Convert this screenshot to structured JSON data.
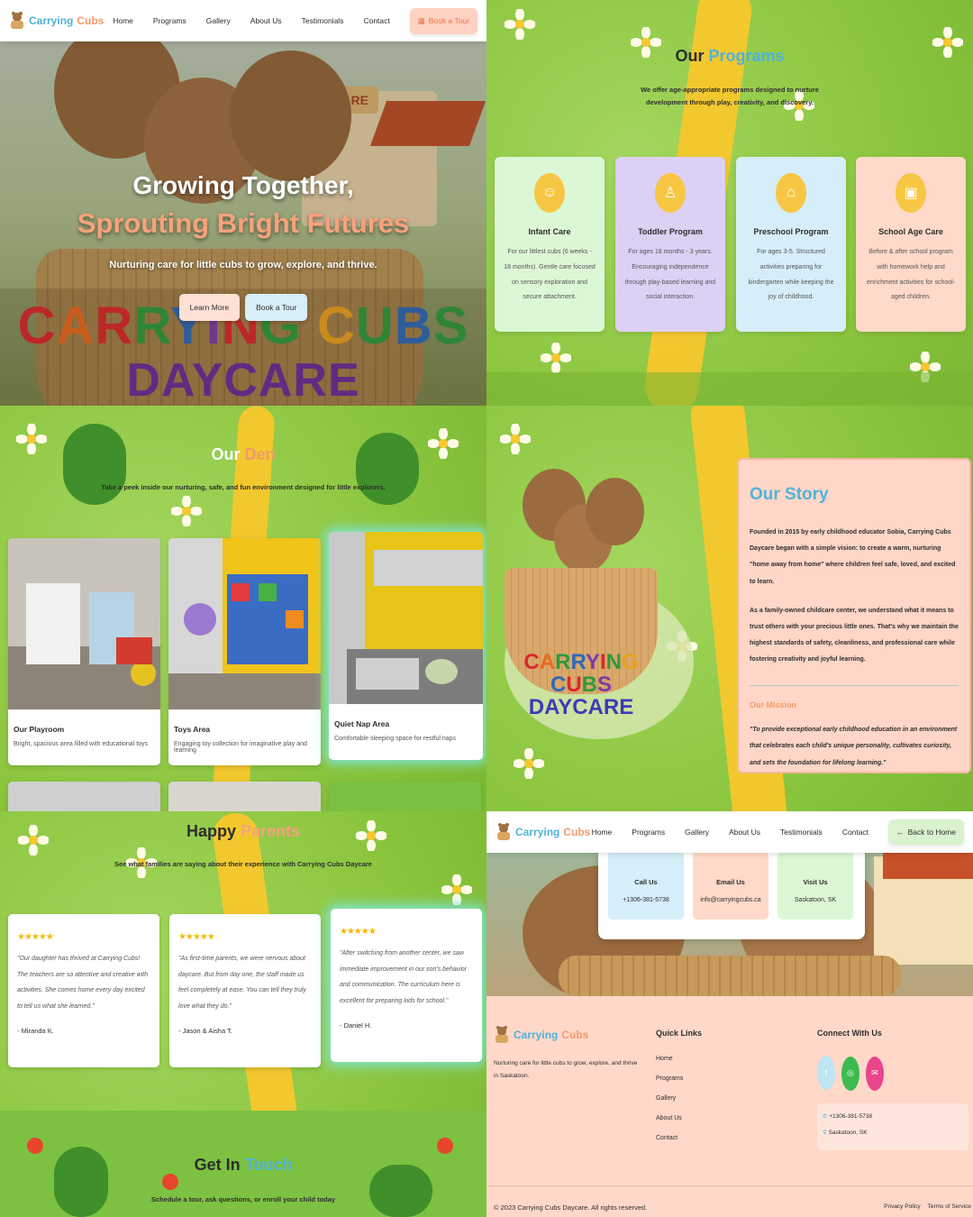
{
  "brand": {
    "word1": "Carrying",
    "word2": "Cubs"
  },
  "nav": {
    "links": [
      "Home",
      "Programs",
      "Gallery",
      "About Us",
      "Testimonials",
      "Contact"
    ],
    "cta": "Book a Tour",
    "back": "Back to Home"
  },
  "hero": {
    "title_line1": "Growing Together,",
    "title_line2": "Sprouting Bright Futures",
    "subtitle": "Nurturing care for little cubs to grow, explore, and thrive.",
    "btn_learn": "Learn More",
    "btn_tour": "Book a Tour",
    "brand_line1": "CARRYING CUBS",
    "brand_line2": "DAYCARE",
    "sign": "DAYCARE"
  },
  "programs": {
    "title_a": "Our",
    "title_b": "Programs",
    "subtitle": "We offer age-appropriate programs designed to nurture development through play, creativity, and discovery.",
    "items": [
      {
        "title": "Infant Care",
        "desc": "For our littlest cubs (6 weeks - 18 months). Gentle care focused on sensory exploration and secure attachment.",
        "bg": "#dcf7d6"
      },
      {
        "title": "Toddler Program",
        "desc": "For ages 18 months - 3 years. Encouraging independence through play-based learning and social interaction.",
        "bg": "#ddd0f5"
      },
      {
        "title": "Preschool Program",
        "desc": "For ages 3-5. Structured activities preparing for kindergarten while keeping the joy of childhood.",
        "bg": "#d6eef9"
      },
      {
        "title": "School Age Care",
        "desc": "Before & after school program with homework help and enrichment activities for school-aged children.",
        "bg": "#ffd9c9"
      }
    ]
  },
  "gallery": {
    "title_a": "Our",
    "title_b": "Den",
    "subtitle": "Take a peek inside our nurturing, safe, and fun environment designed for little explorers.",
    "items": [
      {
        "name": "Our Playroom",
        "desc": "Bright, spacious area filled with educational toys"
      },
      {
        "name": "Toys Area",
        "desc": "Engaging toy collection for imaginative play and learning"
      },
      {
        "name": "Quiet Nap Area",
        "desc": "Comfortable sleeping space for restful naps"
      }
    ]
  },
  "story": {
    "title": "Our Story",
    "p1": "Founded in 2015 by early childhood educator Sobia, Carrying Cubs Daycare began with a simple vision: to create a warm, nurturing \"home away from home\" where children feel safe, loved, and excited to learn.",
    "p2": "As a family-owned childcare center, we understand what it means to trust others with your precious little ones. That's why we maintain the highest standards of safety, cleanliness, and professional care while fostering creativity and joyful learning.",
    "mission_title": "Our Mission",
    "mission": "\"To provide exceptional early childhood education in an environment that celebrates each child's unique personality, cultivates curiosity, and sets the foundation for lifelong learning.\"",
    "art_line1": "CARRYING CUBS",
    "art_line2": "DAYCARE"
  },
  "testimonials": {
    "title_a": "Happy",
    "title_b": "Parents",
    "subtitle": "See what families are saying about their experience with Carrying Cubs Daycare",
    "stars": "★★★★★",
    "items": [
      {
        "quote": "\"Our daughter has thrived at Carrying Cubs! The teachers are so attentive and creative with activities. She comes home every day excited to tell us what she learned.\"",
        "name": "- Miranda K."
      },
      {
        "quote": "\"As first-time parents, we were nervous about daycare. But from day one, the staff made us feel completely at ease. You can tell they truly love what they do.\"",
        "name": "- Jason & Aisha T."
      },
      {
        "quote": "\"After switching from another center, we saw immediate improvement in our son's behavior and communication. The curriculum here is excellent for preparing kids for school.\"",
        "name": "- Daniel H."
      }
    ]
  },
  "contact": {
    "title_a": "Get In",
    "title_b": "Touch",
    "subtitle": "Schedule a tour, ask questions, or enroll your child today",
    "boxes": [
      {
        "label": "Call Us",
        "value": "+1306-381-5738"
      },
      {
        "label": "Email Us",
        "value": "info@carryingcubs.ca"
      },
      {
        "label": "Visit Us",
        "value": "Saskatoon, SK"
      }
    ]
  },
  "footer": {
    "about": "Nurturing care for little cubs to grow, explore, and thrive in Saskatoon.",
    "quick_title": "Quick Links",
    "quick_links": [
      "Home",
      "Programs",
      "Gallery",
      "About Us",
      "Contact"
    ],
    "connect_title": "Connect With Us",
    "phone": "+1306-381-5738",
    "location": "Saskatoon, SK",
    "copyright": "© 2023 Carrying Cubs Daycare. All rights reserved.",
    "privacy": "Privacy Policy",
    "terms": "Terms of Service"
  },
  "colors": {
    "blue": "#4fb3d9",
    "peach": "#f59a6a",
    "grass": "#8dc63f",
    "path": "#f7c72d"
  }
}
